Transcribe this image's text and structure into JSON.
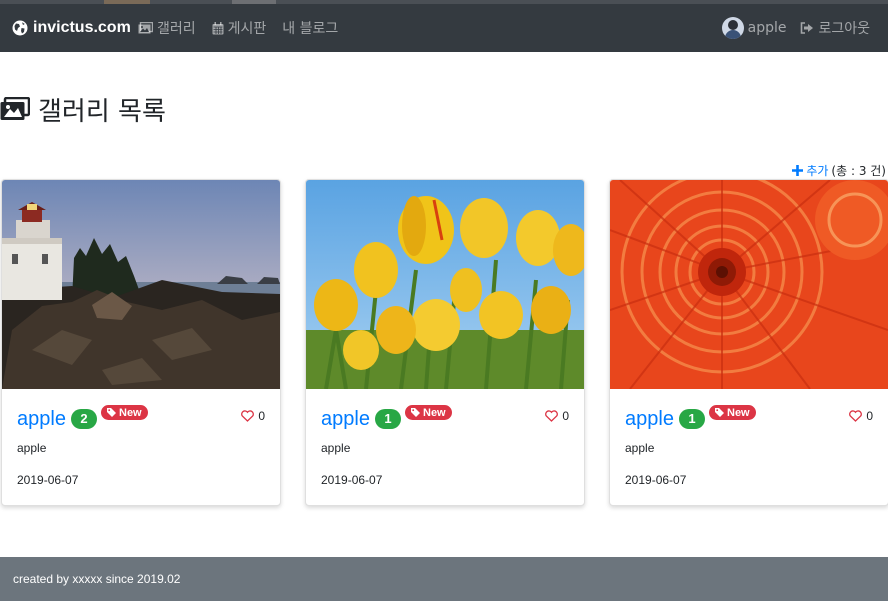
{
  "navbar": {
    "brand": "invictus.com",
    "links": [
      {
        "label": "갤러리",
        "icon": "images-icon"
      },
      {
        "label": "게시판",
        "icon": "calendar-icon"
      },
      {
        "label": "내 블로그"
      }
    ],
    "user": {
      "name": "apple"
    },
    "logout_label": "로그아웃"
  },
  "page": {
    "title": "갤러리 목록"
  },
  "summary": {
    "add_label": "추가",
    "total": "(총 : 3 건)"
  },
  "cards": [
    {
      "title": "apple",
      "count": "2",
      "new_label": "New",
      "likes": "0",
      "text": "apple",
      "date": "2019-06-07",
      "image": "lighthouse"
    },
    {
      "title": "apple",
      "count": "1",
      "new_label": "New",
      "likes": "0",
      "text": "apple",
      "date": "2019-06-07",
      "image": "yellow-tulips"
    },
    {
      "title": "apple",
      "count": "1",
      "new_label": "New",
      "likes": "0",
      "text": "apple",
      "date": "2019-06-07",
      "image": "orange-chrysanthemum"
    }
  ],
  "footer": {
    "text": "created by xxxxx since 2019.02"
  },
  "colors": {
    "navbar": "#343a40",
    "primary": "#007bff",
    "success": "#28a745",
    "danger": "#dc3545",
    "footer": "#6c757d"
  }
}
